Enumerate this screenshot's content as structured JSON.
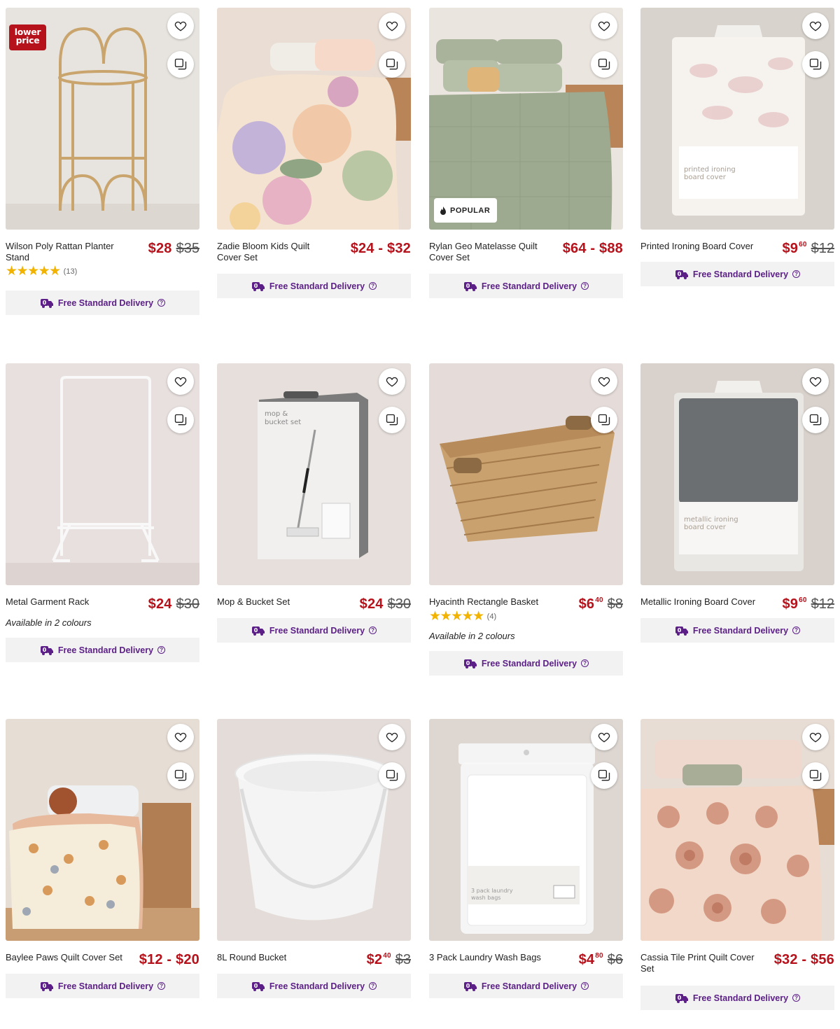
{
  "ui": {
    "delivery_label": "Free Standard Delivery",
    "help_glyph": "?",
    "star_glyphs": "★★★★★",
    "brand_color": "#b5121b",
    "delivery_color": "#5b1f87"
  },
  "products": [
    {
      "name": "Wilson Poly Rattan Planter Stand",
      "price": "$28",
      "was": "$35",
      "badge": "lower\nprice",
      "rating_count": "(13)"
    },
    {
      "name": "Zadie Bloom Kids Quilt Cover Set",
      "price": "$24 - $32"
    },
    {
      "name": "Rylan Geo Matelasse Quilt Cover Set",
      "price": "$64 - $88",
      "popular_label": "POPULAR"
    },
    {
      "name": "Printed Ironing Board Cover",
      "price": "$9",
      "price_cents": "60",
      "was": "$12"
    },
    {
      "name": "Metal Garment Rack",
      "price": "$24",
      "was": "$30",
      "availability": "Available in 2 colours"
    },
    {
      "name": "Mop & Bucket Set",
      "price": "$24",
      "was": "$30"
    },
    {
      "name": "Hyacinth Rectangle Basket",
      "price": "$6",
      "price_cents": "40",
      "was": "$8",
      "rating_count": "(4)",
      "availability": "Available in 2 colours"
    },
    {
      "name": "Metallic Ironing Board Cover",
      "price": "$9",
      "price_cents": "60",
      "was": "$12"
    },
    {
      "name": "Baylee Paws Quilt Cover Set",
      "price": "$12 - $20"
    },
    {
      "name": "8L Round Bucket",
      "price": "$2",
      "price_cents": "40",
      "was": "$3"
    },
    {
      "name": "3 Pack Laundry Wash Bags",
      "price": "$4",
      "price_cents": "80",
      "was": "$6"
    },
    {
      "name": "Cassia Tile Print Quilt Cover Set",
      "price": "$32 - $56"
    }
  ]
}
